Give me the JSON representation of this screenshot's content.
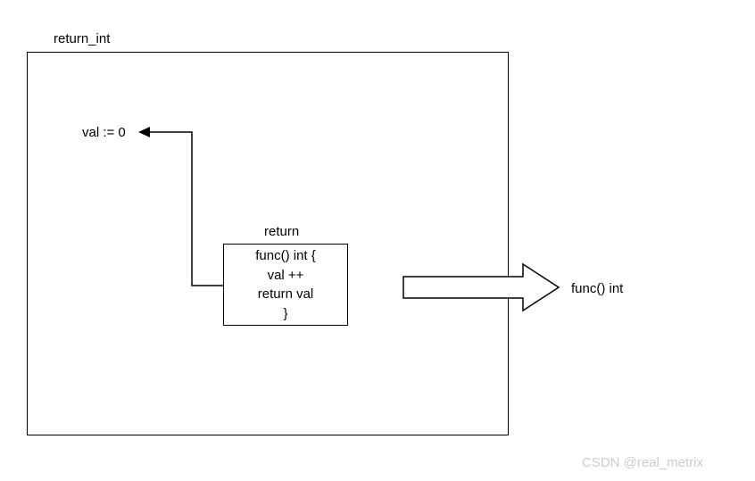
{
  "diagram": {
    "outer_label": "return_int",
    "val_label": "val := 0",
    "inner_label": "return",
    "inner_box": {
      "line1": "func() int {",
      "line2": "val ++",
      "line3": "return val",
      "line4": "}"
    },
    "output_label": "func() int",
    "watermark": "CSDN @real_metrix"
  }
}
